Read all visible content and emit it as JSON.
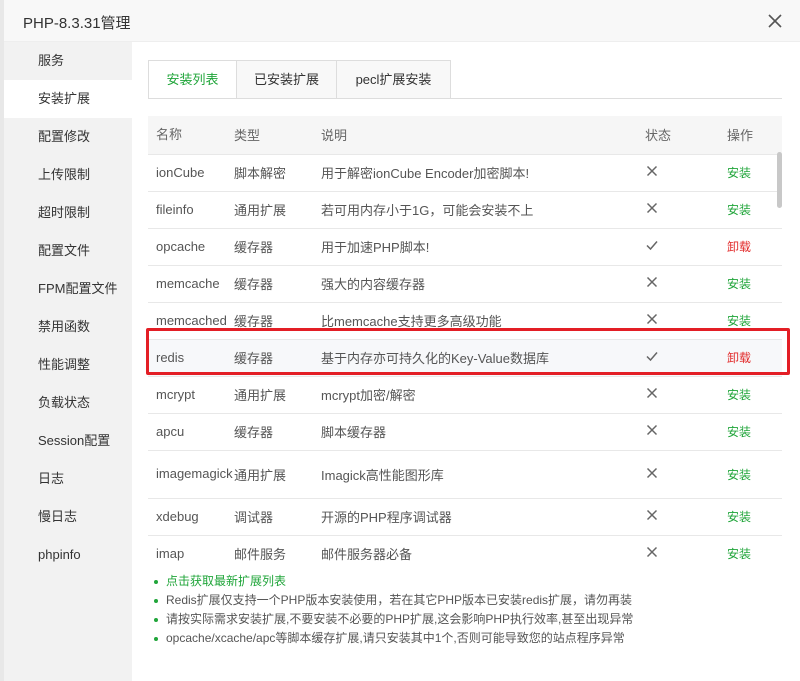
{
  "window": {
    "title": "PHP-8.3.31管理"
  },
  "sidebar": {
    "items": [
      {
        "label": "服务"
      },
      {
        "label": "安装扩展",
        "active": true
      },
      {
        "label": "配置修改"
      },
      {
        "label": "上传限制"
      },
      {
        "label": "超时限制"
      },
      {
        "label": "配置文件"
      },
      {
        "label": "FPM配置文件"
      },
      {
        "label": "禁用函数"
      },
      {
        "label": "性能调整"
      },
      {
        "label": "负载状态"
      },
      {
        "label": "Session配置"
      },
      {
        "label": "日志"
      },
      {
        "label": "慢日志"
      },
      {
        "label": "phpinfo"
      }
    ]
  },
  "tabs": [
    {
      "label": "安装列表",
      "active": true
    },
    {
      "label": "已安装扩展"
    },
    {
      "label": "pecl扩展安装"
    }
  ],
  "table": {
    "headers": {
      "name": "名称",
      "type": "类型",
      "desc": "说明",
      "status": "状态",
      "op": "操作"
    },
    "rows": [
      {
        "name": "ionCube",
        "type": "脚本解密",
        "desc": "用于解密ionCube Encoder加密脚本!",
        "installed": false,
        "op": "安装"
      },
      {
        "name": "fileinfo",
        "type": "通用扩展",
        "desc": "若可用内存小于1G，可能会安装不上",
        "installed": false,
        "op": "安装"
      },
      {
        "name": "opcache",
        "type": "缓存器",
        "desc": "用于加速PHP脚本!",
        "installed": true,
        "op": "卸载"
      },
      {
        "name": "memcache",
        "type": "缓存器",
        "desc": "强大的内容缓存器",
        "installed": false,
        "op": "安装"
      },
      {
        "name": "memcached",
        "type": "缓存器",
        "desc": "比memcache支持更多高级功能",
        "installed": false,
        "op": "安装"
      },
      {
        "name": "redis",
        "type": "缓存器",
        "desc": "基于内存亦可持久化的Key-Value数据库",
        "installed": true,
        "op": "卸载",
        "highlighted": true
      },
      {
        "name": "mcrypt",
        "type": "通用扩展",
        "desc": "mcrypt加密/解密",
        "installed": false,
        "op": "安装"
      },
      {
        "name": "apcu",
        "type": "缓存器",
        "desc": "脚本缓存器",
        "installed": false,
        "op": "安装"
      },
      {
        "name": "imagemagick",
        "type": "通用扩展",
        "desc": "Imagick高性能图形库",
        "installed": false,
        "op": "安装",
        "tall": true
      },
      {
        "name": "xdebug",
        "type": "调试器",
        "desc": "开源的PHP程序调试器",
        "installed": false,
        "op": "安装"
      },
      {
        "name": "imap",
        "type": "邮件服务",
        "desc": "邮件服务器必备",
        "installed": false,
        "op": "安装"
      }
    ]
  },
  "notes": [
    "点击获取最新扩展列表",
    "Redis扩展仅支持一个PHP版本安装使用，若在其它PHP版本已安装redis扩展，请勿再装",
    "请按实际需求安装扩展,不要安装不必要的PHP扩展,这会影响PHP执行效率,甚至出现异常",
    "opcache/xcache/apc等脚本缓存扩展,请只安装其中1个,否则可能导致您的站点程序异常"
  ],
  "colors": {
    "accent": "#20a53a",
    "danger": "#e22b2b",
    "highlight": "#e31e25"
  },
  "icons": {
    "close": "close-icon",
    "installed": "check-icon",
    "not_installed": "cross-icon"
  }
}
